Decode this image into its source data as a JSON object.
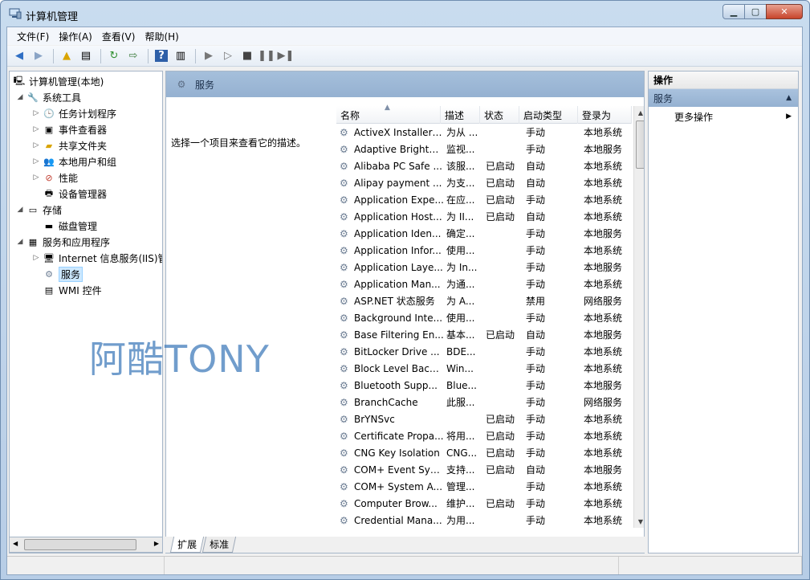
{
  "window": {
    "title": "计算机管理"
  },
  "menu": {
    "items": [
      "文件(F)",
      "操作(A)",
      "查看(V)",
      "帮助(H)"
    ]
  },
  "toolbar": {
    "buttons": [
      "back-icon",
      "forward-icon",
      "up-icon",
      "show-hide-tree-icon",
      "refresh-icon",
      "export-icon",
      "help-icon",
      "show-hide-action-icon",
      "start-icon",
      "start-alt-icon",
      "stop-icon",
      "pause-icon",
      "restart-icon"
    ]
  },
  "tree": {
    "items": [
      {
        "label": "计算机管理(本地)",
        "level": 0,
        "expander": "",
        "icon": "computer-icon"
      },
      {
        "label": "系统工具",
        "level": 1,
        "expander": "◢",
        "icon": "tools-icon"
      },
      {
        "label": "任务计划程序",
        "level": 2,
        "expander": "▷",
        "icon": "clock-icon"
      },
      {
        "label": "事件查看器",
        "level": 2,
        "expander": "▷",
        "icon": "event-viewer-icon"
      },
      {
        "label": "共享文件夹",
        "level": 2,
        "expander": "▷",
        "icon": "shared-folder-icon"
      },
      {
        "label": "本地用户和组",
        "level": 2,
        "expander": "▷",
        "icon": "users-icon"
      },
      {
        "label": "性能",
        "level": 2,
        "expander": "▷",
        "icon": "performance-icon"
      },
      {
        "label": "设备管理器",
        "level": 2,
        "expander": "",
        "icon": "device-manager-icon"
      },
      {
        "label": "存储",
        "level": 1,
        "expander": "◢",
        "icon": "storage-icon"
      },
      {
        "label": "磁盘管理",
        "level": 2,
        "expander": "",
        "icon": "disk-icon"
      },
      {
        "label": "服务和应用程序",
        "level": 1,
        "expander": "◢",
        "icon": "services-apps-icon"
      },
      {
        "label": "Internet 信息服务(IIS)管",
        "level": 2,
        "expander": "▷",
        "icon": "iis-icon"
      },
      {
        "label": "服务",
        "level": 2,
        "expander": "",
        "icon": "services-icon",
        "selected": true
      },
      {
        "label": "WMI 控件",
        "level": 2,
        "expander": "",
        "icon": "wmi-icon"
      }
    ]
  },
  "center": {
    "header_title": "服务",
    "description_prompt": "选择一个项目来查看它的描述。",
    "columns": [
      "名称",
      "描述",
      "状态",
      "启动类型",
      "登录为"
    ],
    "rows": [
      [
        "ActiveX Installer ...",
        "为从 ...",
        "",
        "手动",
        "本地系统"
      ],
      [
        "Adaptive Brightn...",
        "监视...",
        "",
        "手动",
        "本地服务"
      ],
      [
        "Alibaba PC Safe ...",
        "该服...",
        "已启动",
        "自动",
        "本地系统"
      ],
      [
        "Alipay payment ...",
        "为支...",
        "已启动",
        "自动",
        "本地系统"
      ],
      [
        "Application Expe...",
        "在应...",
        "已启动",
        "手动",
        "本地系统"
      ],
      [
        "Application Host...",
        "为 II...",
        "已启动",
        "自动",
        "本地系统"
      ],
      [
        "Application Iden...",
        "确定...",
        "",
        "手动",
        "本地服务"
      ],
      [
        "Application Infor...",
        "使用...",
        "",
        "手动",
        "本地系统"
      ],
      [
        "Application Laye...",
        "为 In...",
        "",
        "手动",
        "本地服务"
      ],
      [
        "Application Man...",
        "为通...",
        "",
        "手动",
        "本地系统"
      ],
      [
        "ASP.NET 状态服务",
        "为 A...",
        "",
        "禁用",
        "网络服务"
      ],
      [
        "Background Inte...",
        "使用...",
        "",
        "手动",
        "本地系统"
      ],
      [
        "Base Filtering En...",
        "基本...",
        "已启动",
        "自动",
        "本地服务"
      ],
      [
        "BitLocker Drive ...",
        "BDE...",
        "",
        "手动",
        "本地系统"
      ],
      [
        "Block Level Back...",
        "Win...",
        "",
        "手动",
        "本地系统"
      ],
      [
        "Bluetooth Supp...",
        "Blue...",
        "",
        "手动",
        "本地服务"
      ],
      [
        "BranchCache",
        "此服...",
        "",
        "手动",
        "网络服务"
      ],
      [
        "BrYNSvc",
        "",
        "已启动",
        "手动",
        "本地系统"
      ],
      [
        "Certificate Propa...",
        "将用...",
        "已启动",
        "手动",
        "本地系统"
      ],
      [
        "CNG Key Isolation",
        "CNG...",
        "已启动",
        "手动",
        "本地系统"
      ],
      [
        "COM+ Event Sys...",
        "支持...",
        "已启动",
        "自动",
        "本地服务"
      ],
      [
        "COM+ System A...",
        "管理...",
        "",
        "手动",
        "本地系统"
      ],
      [
        "Computer Brow...",
        "维护...",
        "已启动",
        "手动",
        "本地系统"
      ],
      [
        "Credential Mana...",
        "为用...",
        "",
        "手动",
        "本地系统"
      ]
    ]
  },
  "tabs": [
    "扩展",
    "标准"
  ],
  "actions": {
    "title": "操作",
    "section": "服务",
    "items": [
      "更多操作"
    ]
  },
  "watermark": "阿酷TONY"
}
